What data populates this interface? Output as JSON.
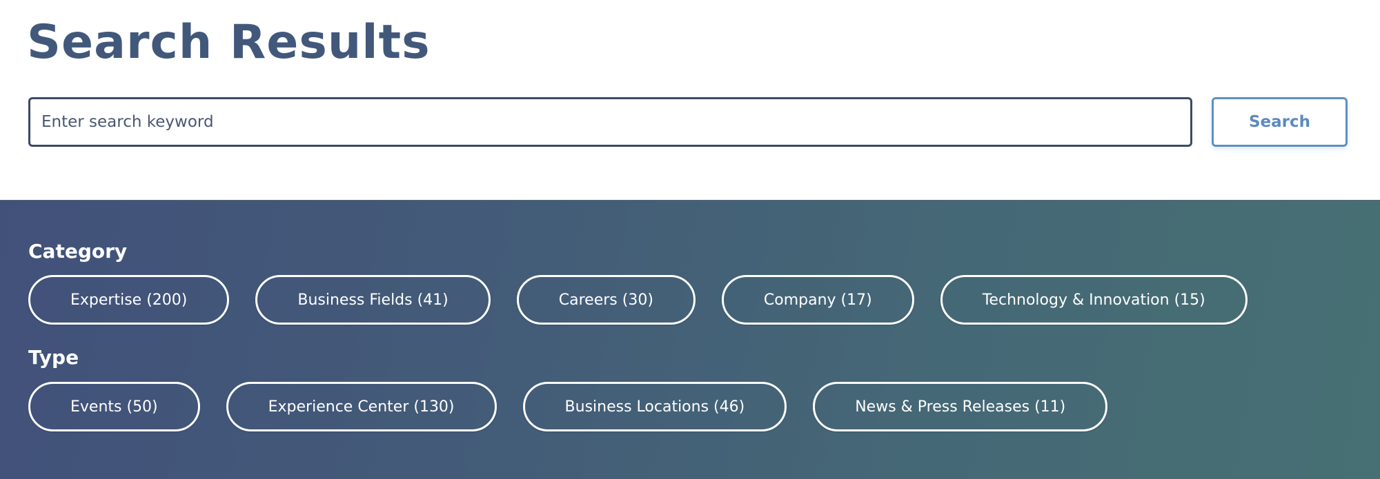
{
  "header": {
    "title": "Search Results"
  },
  "search": {
    "placeholder": "Enter search keyword",
    "value": "",
    "button_label": "Search"
  },
  "colors": {
    "title": "#42587b",
    "input_border": "#3b4a64",
    "button_accent": "#5d8fc7",
    "panel_gradient_start": "#42517a",
    "panel_gradient_end": "#467073",
    "pill_border": "#ffffff"
  },
  "filters": {
    "category": {
      "label": "Category",
      "items": [
        {
          "label": "Expertise (200)",
          "name": "Expertise",
          "count": 200
        },
        {
          "label": "Business Fields (41)",
          "name": "Business Fields",
          "count": 41
        },
        {
          "label": "Careers (30)",
          "name": "Careers",
          "count": 30
        },
        {
          "label": "Company (17)",
          "name": "Company",
          "count": 17
        },
        {
          "label": "Technology & Innovation (15)",
          "name": "Technology & Innovation",
          "count": 15
        }
      ]
    },
    "type": {
      "label": "Type",
      "items": [
        {
          "label": "Events (50)",
          "name": "Events",
          "count": 50
        },
        {
          "label": "Experience Center (130)",
          "name": "Experience Center",
          "count": 130
        },
        {
          "label": "Business Locations (46)",
          "name": "Business Locations",
          "count": 46
        },
        {
          "label": "News & Press Releases (11)",
          "name": "News & Press Releases",
          "count": 11
        }
      ]
    }
  }
}
